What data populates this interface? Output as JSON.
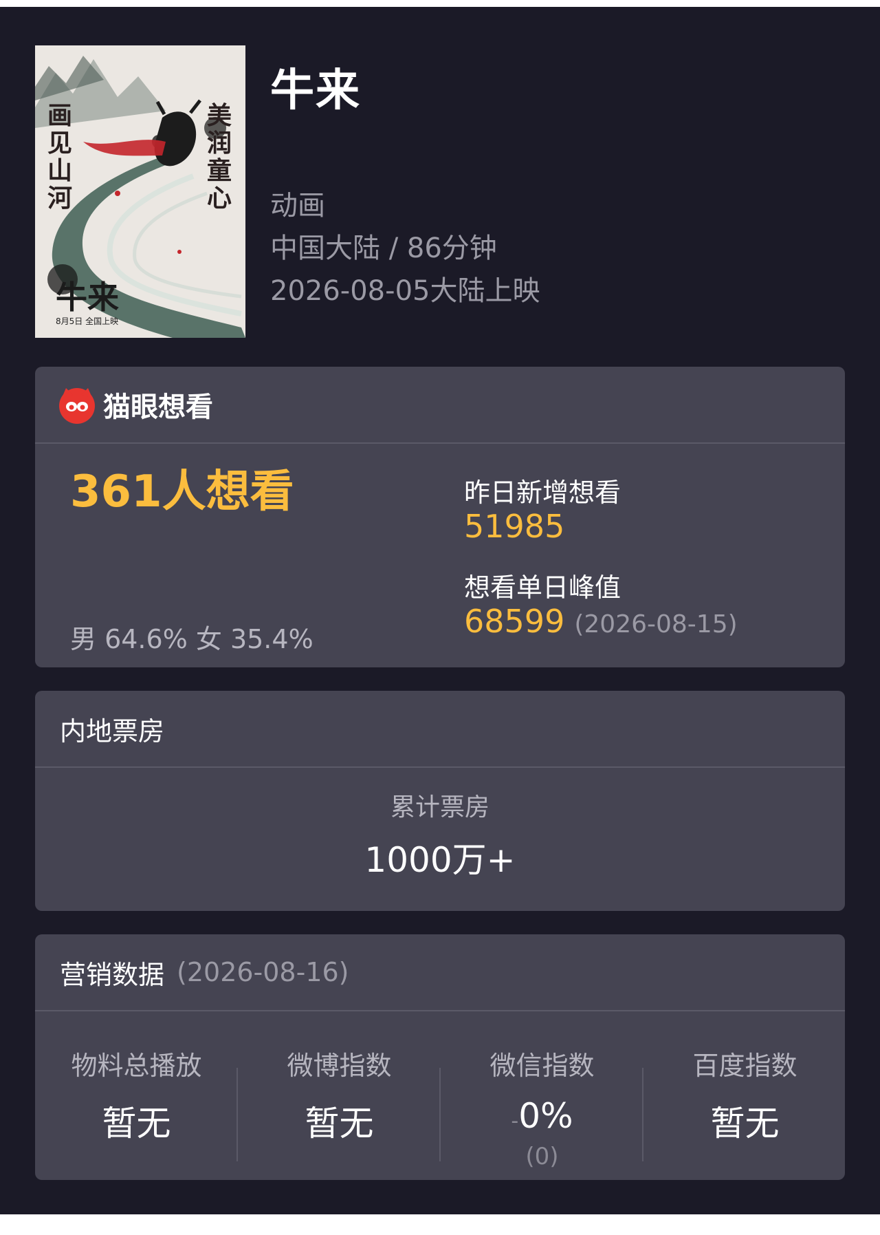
{
  "movie": {
    "title": "牛来",
    "genre": "动画",
    "region_duration": "中国大陆 / 86分钟",
    "release": "2026-08-05大陆上映",
    "poster": {
      "calligraphy_left": "画见山河",
      "calligraphy_right": "美润童心",
      "title_brush": "牛来",
      "release_small": "8月5日 全国上映"
    }
  },
  "want": {
    "brand_label": "猫眼想看",
    "brand_icon": "maoyan-cat-icon",
    "count_text": "361人想看",
    "gender_text": "男 64.6% 女 35.4%",
    "yesterday_label": "昨日新增想看",
    "yesterday_value": "51985",
    "peak_label": "想看单日峰值",
    "peak_value": "68599",
    "peak_date": "(2026-08-15)"
  },
  "boxoffice": {
    "section_title": "内地票房",
    "total_label": "累计票房",
    "total_value": "1000万+"
  },
  "marketing": {
    "section_title": "营销数据",
    "date": "(2026-08-16)",
    "items": [
      {
        "label": "物料总播放",
        "value": "暂无"
      },
      {
        "label": "微博指数",
        "value": "暂无"
      },
      {
        "label": "微信指数",
        "prefix": "-",
        "value": "0%",
        "sub": "(0)"
      },
      {
        "label": "百度指数",
        "value": "暂无"
      }
    ]
  },
  "colors": {
    "page_bg": "#1b1a27",
    "card_bg": "#454452",
    "accent_yellow": "#fbbd3e",
    "brand_red": "#e8352f"
  }
}
